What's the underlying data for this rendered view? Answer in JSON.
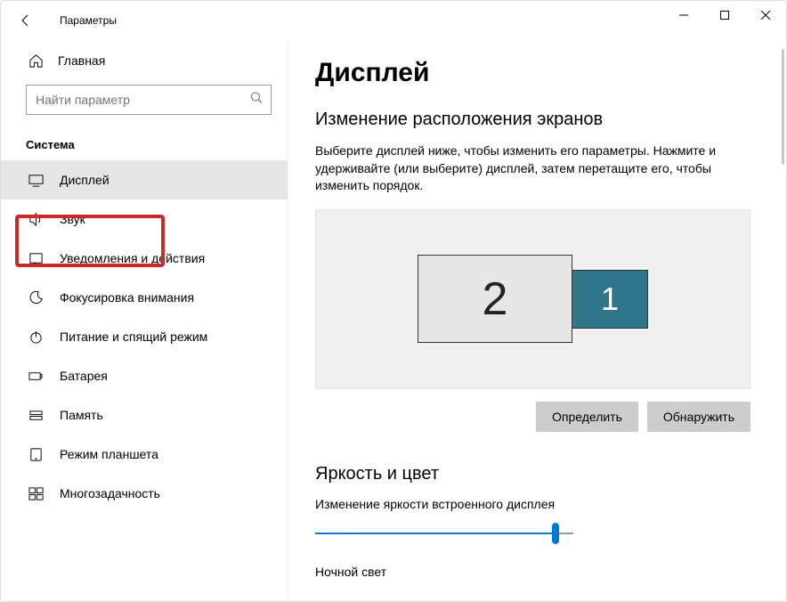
{
  "window": {
    "title": "Параметры"
  },
  "sidebar": {
    "home": "Главная",
    "search_placeholder": "Найти параметр",
    "group": "Система",
    "items": [
      {
        "id": "display",
        "label": "Дисплей",
        "active": true
      },
      {
        "id": "sound",
        "label": "Звук"
      },
      {
        "id": "notifications",
        "label": "Уведомления и действия"
      },
      {
        "id": "focus",
        "label": "Фокусировка внимания"
      },
      {
        "id": "power",
        "label": "Питание и спящий режим"
      },
      {
        "id": "battery",
        "label": "Батарея"
      },
      {
        "id": "storage",
        "label": "Память"
      },
      {
        "id": "tablet",
        "label": "Режим планшета"
      },
      {
        "id": "multitask",
        "label": "Многозадачность"
      }
    ]
  },
  "main": {
    "title": "Дисплей",
    "arrange_heading": "Изменение расположения экранов",
    "arrange_hint": "Выберите дисплей ниже, чтобы изменить его параметры. Нажмите и удерживайте (или выберите) дисплей, затем перетащите его, чтобы изменить порядок.",
    "monitors": {
      "m2": "2",
      "m1": "1"
    },
    "identify_btn": "Определить",
    "detect_btn": "Обнаружить",
    "brightness_heading": "Яркость и цвет",
    "brightness_label": "Изменение яркости встроенного дисплея",
    "night_light_label": "Ночной свет"
  }
}
